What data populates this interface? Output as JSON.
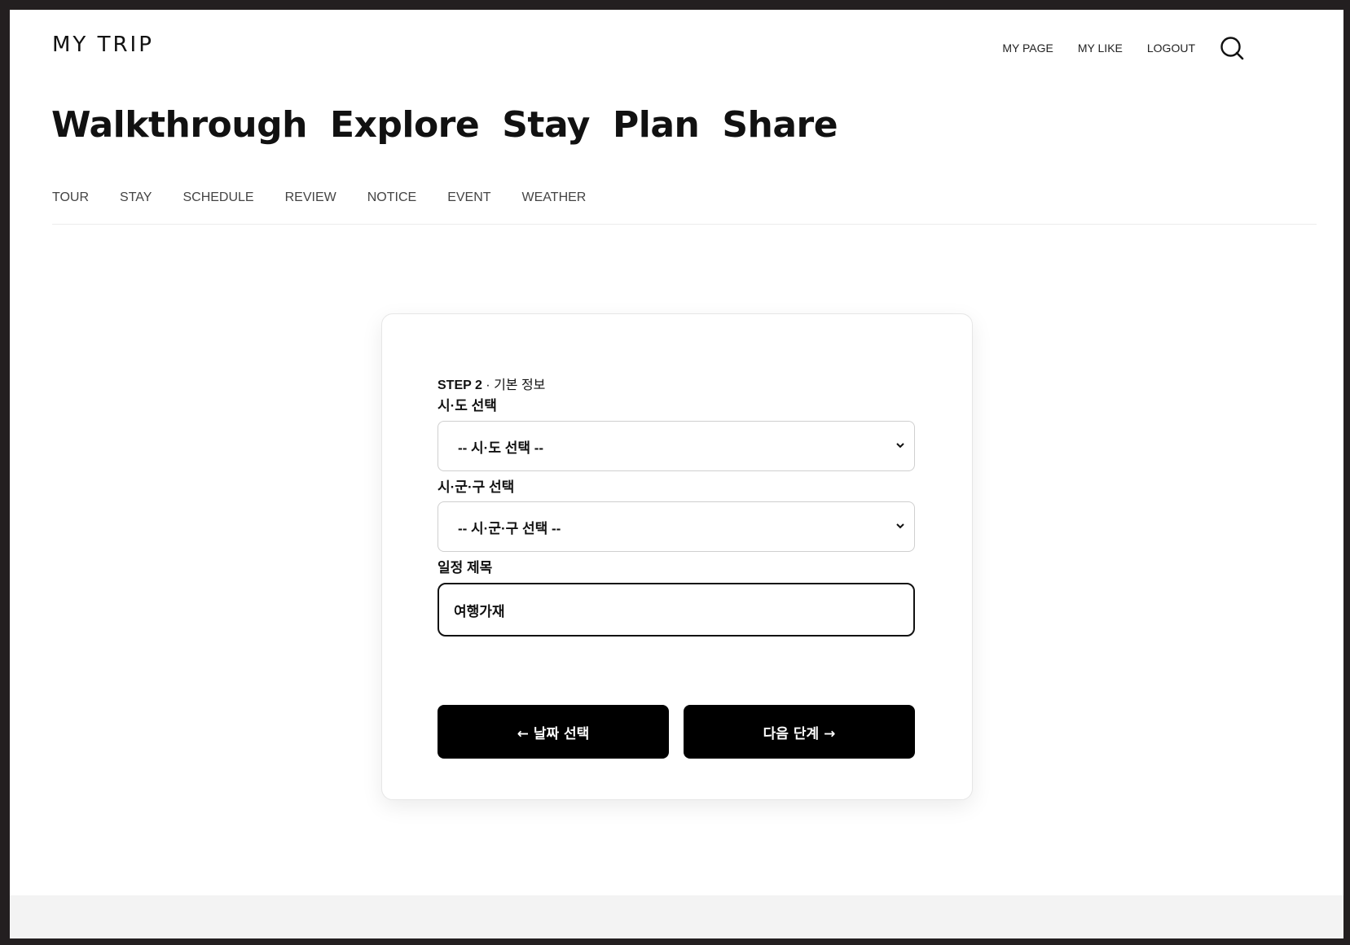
{
  "header": {
    "logo": "MY TRIP",
    "util_links": {
      "my_page": "MY PAGE",
      "my_like": "MY LIKE",
      "logout": "LOGOUT"
    },
    "search_icon": "search-icon"
  },
  "main_nav": {
    "walkthrough": "Walkthrough",
    "explore": "Explore",
    "stay": "Stay",
    "plan": "Plan",
    "share": "Share"
  },
  "sub_nav": {
    "tour": "TOUR",
    "stay": "STAY",
    "schedule": "SCHEDULE",
    "review": "REVIEW",
    "notice": "NOTICE",
    "event": "EVENT",
    "weather": "WEATHER"
  },
  "form": {
    "step_label": "STEP 2",
    "step_separator": " · ",
    "step_title": "기본 정보",
    "province_label": "시·도 선택",
    "province_selected": "-- 시·도 선택 --",
    "district_label": "시·군·구 선택",
    "district_selected": "-- 시·군·구 선택 --",
    "title_label": "일정 제목",
    "title_value": "여행가재",
    "prev_button": "← 날짜 선택",
    "next_button": "다음 단계 →"
  },
  "colors": {
    "background": "#ffffff",
    "frame": "#231f20",
    "button": "#000000",
    "button_text": "#ffffff",
    "footer_band": "#f3f3f3"
  }
}
